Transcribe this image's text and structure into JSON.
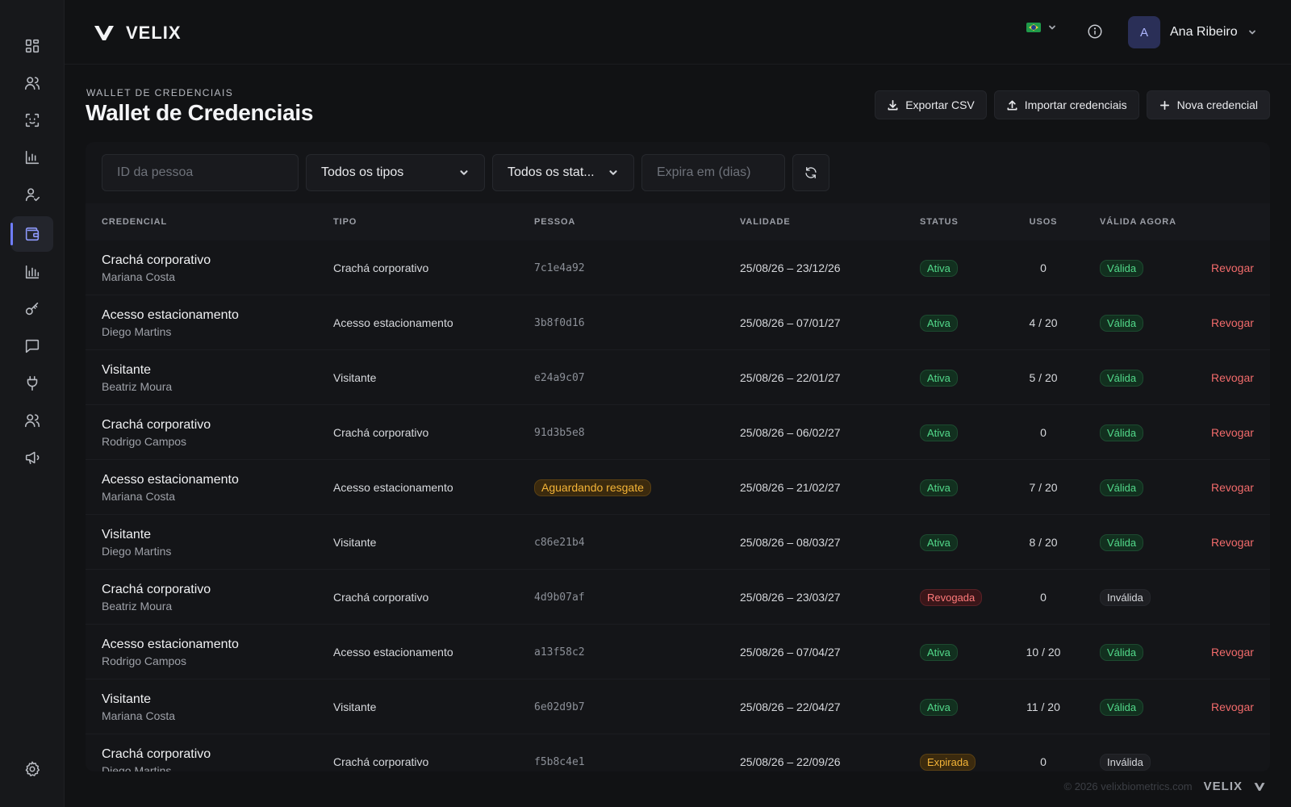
{
  "brand": {
    "name": "VELIX"
  },
  "header": {
    "user_name": "Ana Ribeiro",
    "user_initial": "A"
  },
  "page": {
    "breadcrumb": "WALLET DE CREDENCIAIS",
    "title": "Wallet de Credenciais",
    "actions": {
      "export": "Exportar CSV",
      "import": "Importar credenciais",
      "new": "Nova credencial"
    }
  },
  "filters": {
    "person_placeholder": "ID da pessoa",
    "type_selected": "Todos os tipos",
    "status_selected": "Todos os stat...",
    "expires_placeholder": "Expira em (dias)"
  },
  "table": {
    "columns": {
      "credencial": "CREDENCIAL",
      "tipo": "TIPO",
      "pessoa": "PESSOA",
      "validade": "VALIDADE",
      "status": "STATUS",
      "usos": "USOS",
      "valida": "VÁLIDA AGORA"
    },
    "rows": [
      {
        "name": "Crachá corporativo",
        "person": "Mariana Costa",
        "tipo": "Crachá corporativo",
        "pessoa": "7c1e4a92",
        "validade": "25/08/26 – 23/12/26",
        "status": "Ativa",
        "status_kind": "ativa",
        "usos": "0",
        "valida": "Válida",
        "valida_kind": "valida",
        "action": "Revogar"
      },
      {
        "name": "Acesso estacionamento",
        "person": "Diego Martins",
        "tipo": "Acesso estacionamento",
        "pessoa": "3b8f0d16",
        "validade": "25/08/26 – 07/01/27",
        "status": "Ativa",
        "status_kind": "ativa",
        "usos": "4 / 20",
        "valida": "Válida",
        "valida_kind": "valida",
        "action": "Revogar"
      },
      {
        "name": "Visitante",
        "person": "Beatriz Moura",
        "tipo": "Visitante",
        "pessoa": "e24a9c07",
        "validade": "25/08/26 – 22/01/27",
        "status": "Ativa",
        "status_kind": "ativa",
        "usos": "5 / 20",
        "valida": "Válida",
        "valida_kind": "valida",
        "action": "Revogar"
      },
      {
        "name": "Crachá corporativo",
        "person": "Rodrigo Campos",
        "tipo": "Crachá corporativo",
        "pessoa": "91d3b5e8",
        "validade": "25/08/26 – 06/02/27",
        "status": "Ativa",
        "status_kind": "ativa",
        "usos": "0",
        "valida": "Válida",
        "valida_kind": "valida",
        "action": "Revogar"
      },
      {
        "name": "Acesso estacionamento",
        "person": "Mariana Costa",
        "tipo": "Acesso estacionamento",
        "pessoa": "Aguardando resgate",
        "pessoa_kind": "aguard",
        "validade": "25/08/26 – 21/02/27",
        "status": "Ativa",
        "status_kind": "ativa",
        "usos": "7 / 20",
        "valida": "Válida",
        "valida_kind": "valida",
        "action": "Revogar"
      },
      {
        "name": "Visitante",
        "person": "Diego Martins",
        "tipo": "Visitante",
        "pessoa": "c86e21b4",
        "validade": "25/08/26 – 08/03/27",
        "status": "Ativa",
        "status_kind": "ativa",
        "usos": "8 / 20",
        "valida": "Válida",
        "valida_kind": "valida",
        "action": "Revogar"
      },
      {
        "name": "Crachá corporativo",
        "person": "Beatriz Moura",
        "tipo": "Crachá corporativo",
        "pessoa": "4d9b07af",
        "validade": "25/08/26 – 23/03/27",
        "status": "Revogada",
        "status_kind": "revogada",
        "usos": "0",
        "valida": "Inválida",
        "valida_kind": "invalida",
        "action": ""
      },
      {
        "name": "Acesso estacionamento",
        "person": "Rodrigo Campos",
        "tipo": "Acesso estacionamento",
        "pessoa": "a13f58c2",
        "validade": "25/08/26 – 07/04/27",
        "status": "Ativa",
        "status_kind": "ativa",
        "usos": "10 / 20",
        "valida": "Válida",
        "valida_kind": "valida",
        "action": "Revogar"
      },
      {
        "name": "Visitante",
        "person": "Mariana Costa",
        "tipo": "Visitante",
        "pessoa": "6e02d9b7",
        "validade": "25/08/26 – 22/04/27",
        "status": "Ativa",
        "status_kind": "ativa",
        "usos": "11 / 20",
        "valida": "Válida",
        "valida_kind": "valida",
        "action": "Revogar"
      },
      {
        "name": "Crachá corporativo",
        "person": "Diego Martins",
        "tipo": "Crachá corporativo",
        "pessoa": "f5b8c4e1",
        "validade": "25/08/26 – 22/09/26",
        "status": "Expirada",
        "status_kind": "expirada",
        "usos": "0",
        "valida": "Inválida",
        "valida_kind": "invalida",
        "action": ""
      }
    ]
  },
  "footer": {
    "copyright": "© 2026 velixbiometrics.com",
    "brand": "VELIX"
  },
  "sidebar": {
    "icons": [
      "dashboard-icon",
      "users-icon",
      "face-scan-icon",
      "chart-icon",
      "user-check-icon",
      "wallet-icon",
      "bar-chart-icon",
      "key-icon",
      "message-icon",
      "plug-icon",
      "team-icon",
      "megaphone-icon",
      "settings-icon"
    ],
    "active": "wallet-icon"
  },
  "colors": {
    "accent": "#6f7dff",
    "success": "#52d98a",
    "danger": "#f26b6b",
    "warning": "#f4b437"
  }
}
